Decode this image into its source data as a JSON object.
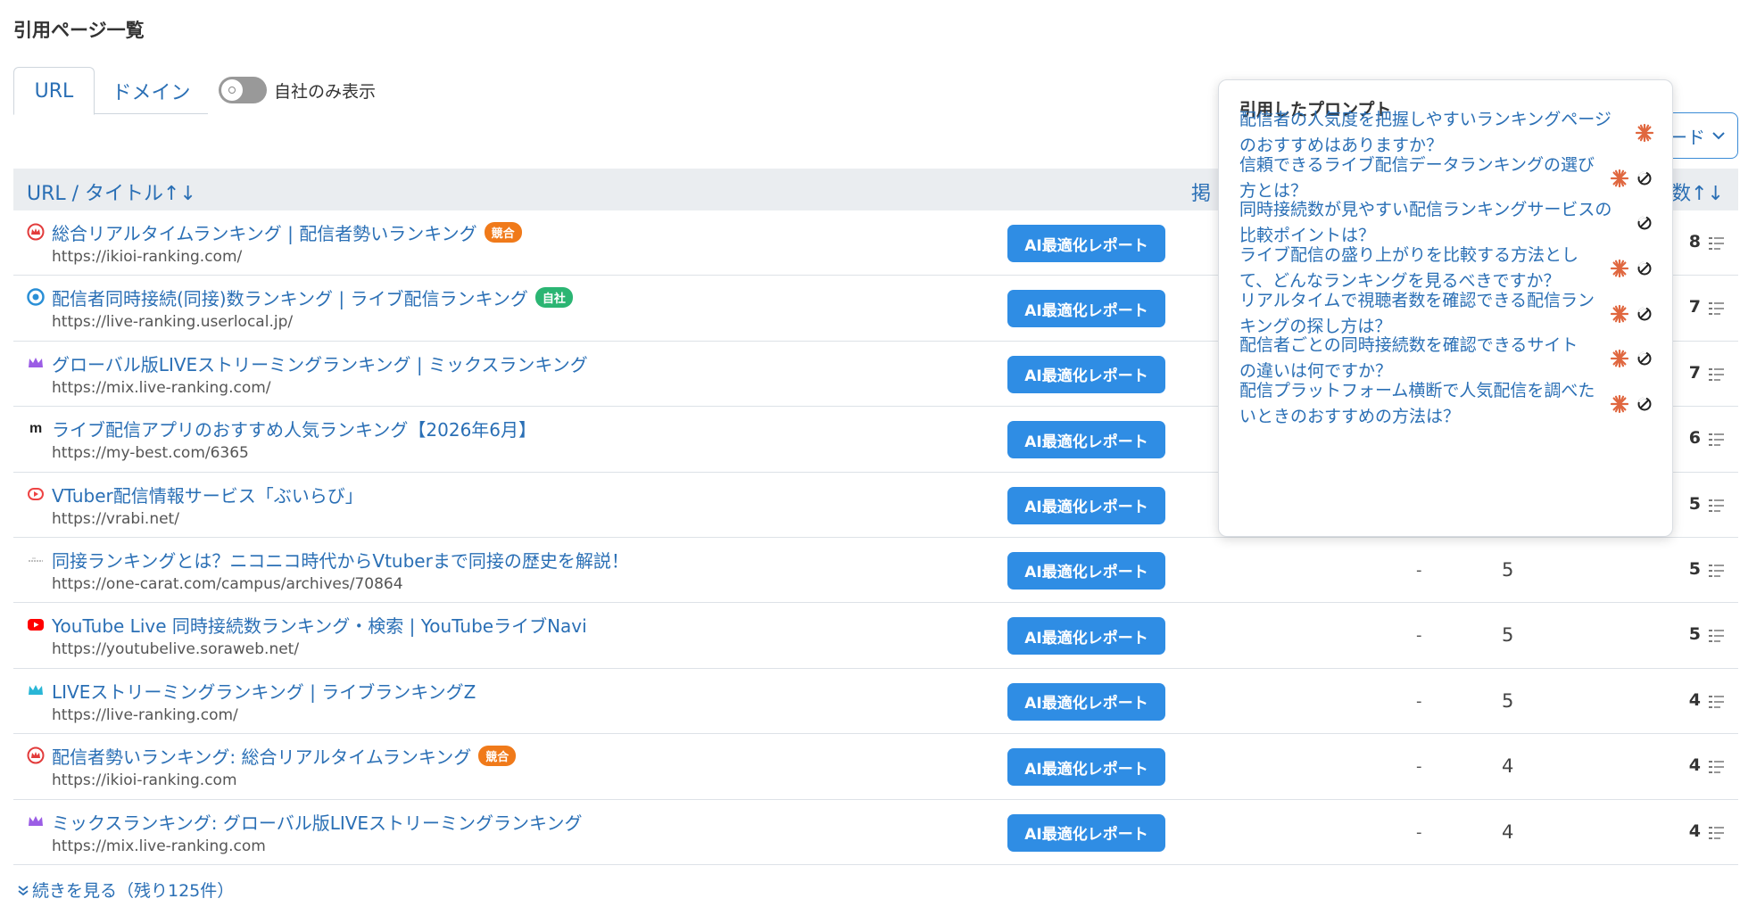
{
  "page": {
    "title": "引用ページ一覧"
  },
  "tabs": [
    {
      "label": "URL",
      "active": true
    },
    {
      "label": "ドメイン",
      "active": false
    }
  ],
  "toggle": {
    "label": "自社のみ表示",
    "on": false
  },
  "dropdown": {
    "label": "ード"
  },
  "table": {
    "header_url": "URL / タイトル↑↓",
    "header_mid": "掲",
    "header_count": "数↑↓"
  },
  "rows": [
    {
      "favicon": "crown-icon",
      "title": "総合リアルタイムランキング | 配信者勢いランキング",
      "badge": "競合",
      "badge_type": "competitor",
      "url": "https://ikioi-ranking.com/",
      "button": "AI最適化レポート",
      "dash": "",
      "mid": "",
      "count": "8"
    },
    {
      "favicon": "userlocal-icon",
      "title": "配信者同時接続(同接)数ランキング | ライブ配信ランキング",
      "badge": "自社",
      "badge_type": "own",
      "url": "https://live-ranking.userlocal.jp/",
      "button": "AI最適化レポート",
      "dash": "",
      "mid": "",
      "count": "7"
    },
    {
      "favicon": "purple-crown-icon",
      "title": "グローバル版LIVEストリーミングランキング | ミックスランキング",
      "badge": "",
      "badge_type": "",
      "url": "https://mix.live-ranking.com/",
      "button": "AI最適化レポート",
      "dash": "",
      "mid": "",
      "count": "7"
    },
    {
      "favicon": "mybest-icon",
      "title": "ライブ配信アプリのおすすめ人気ランキング【2026年6月】",
      "badge": "",
      "badge_type": "",
      "url": "https://my-best.com/6365",
      "button": "AI最適化レポート",
      "dash": "",
      "mid": "",
      "count": "6"
    },
    {
      "favicon": "vrabi-icon",
      "title": "VTuber配信情報サービス「ぶいらび」",
      "badge": "",
      "badge_type": "",
      "url": "https://vrabi.net/",
      "button": "AI最適化レポート",
      "dash": "",
      "mid": "",
      "count": "5"
    },
    {
      "favicon": "onecarat-icon",
      "title": "同接ランキングとは？ニコニコ時代からVtuberまで同接の歴史を解説！",
      "badge": "",
      "badge_type": "",
      "url": "https://one-carat.com/campus/archives/70864",
      "button": "AI最適化レポート",
      "dash": "-",
      "mid": "5",
      "count": "5"
    },
    {
      "favicon": "youtube-icon",
      "title": "YouTube Live 同時接続数ランキング・検索 | YouTubeライブNavi",
      "badge": "",
      "badge_type": "",
      "url": "https://youtubelive.soraweb.net/",
      "button": "AI最適化レポート",
      "dash": "-",
      "mid": "5",
      "count": "5"
    },
    {
      "favicon": "teal-crown-icon",
      "title": "LIVEストリーミングランキング | ライブランキングZ",
      "badge": "",
      "badge_type": "",
      "url": "https://live-ranking.com/",
      "button": "AI最適化レポート",
      "dash": "-",
      "mid": "5",
      "count": "4"
    },
    {
      "favicon": "crown-icon",
      "title": "配信者勢いランキング: 総合リアルタイムランキング",
      "badge": "競合",
      "badge_type": "competitor",
      "url": "https://ikioi-ranking.com",
      "button": "AI最適化レポート",
      "dash": "-",
      "mid": "4",
      "count": "4"
    },
    {
      "favicon": "purple-crown-icon",
      "title": "ミックスランキング: グローバル版LIVEストリーミングランキング",
      "badge": "",
      "badge_type": "",
      "url": "https://mix.live-ranking.com",
      "button": "AI最適化レポート",
      "dash": "-",
      "mid": "4",
      "count": "4"
    }
  ],
  "more": {
    "label": "続きを見る（残り125件）"
  },
  "popover": {
    "title": "引用したプロンプト",
    "prompts": [
      {
        "line1": "配信者の人気度を把握しやすいランキングページ",
        "line2": "のおすすめはありますか？",
        "claude": true,
        "chatgpt": false
      },
      {
        "line1": "信頼できるライブ配信データランキングの選び",
        "line2": "方とは？",
        "claude": true,
        "chatgpt": true
      },
      {
        "line1": "同時接続数が見やすい配信ランキングサービスの",
        "line2": "比較ポイントは？",
        "claude": false,
        "chatgpt": true
      },
      {
        "line1": "ライブ配信の盛り上がりを比較する方法とし",
        "line2": "て、どんなランキングを見るべきですか？",
        "claude": true,
        "chatgpt": true
      },
      {
        "line1": "リアルタイムで視聴者数を確認できる配信ラン",
        "line2": "キングの探し方は？",
        "claude": true,
        "chatgpt": true
      },
      {
        "line1": "配信者ごとの同時接続数を確認できるサイト",
        "line2": "の違いは何ですか？",
        "claude": true,
        "chatgpt": true
      },
      {
        "line1": "配信プラットフォーム横断で人気配信を調べた",
        "line2": "いときのおすすめの方法は？",
        "claude": true,
        "chatgpt": true
      }
    ]
  },
  "colors": {
    "link": "#2a6fb5",
    "button": "#2f8de4",
    "competitor": "#f07a1a",
    "own": "#2bb573",
    "claude": "#e0673f"
  }
}
